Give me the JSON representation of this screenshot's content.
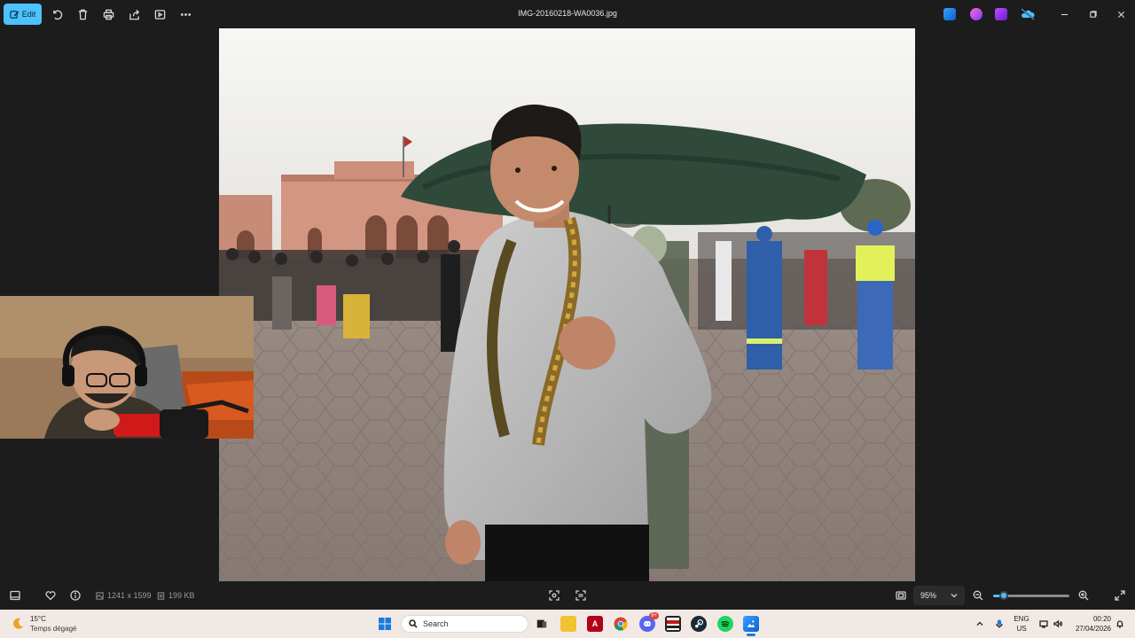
{
  "toolbar": {
    "edit_label": "Edit",
    "title": "IMG-20160218-WA0036.jpg",
    "icons": [
      "rotate-icon",
      "delete-icon",
      "print-icon",
      "share-icon",
      "slideshow-icon",
      "more-icon"
    ],
    "app_icons": [
      "photo-editor-app-icon",
      "clipchamp-app-icon",
      "video-editor-app-icon",
      "onedrive-off-icon"
    ]
  },
  "footer": {
    "dimensions": "1241 x 1599",
    "file_size": "199 KB",
    "zoom_value": "95%",
    "zoom_level": 0.14
  },
  "taskbar": {
    "temperature": "15°C",
    "weather": "Temps dégagé",
    "search_placeholder": "Search",
    "language": "ENG",
    "region": "US",
    "time": "00:20",
    "date": "27/04/2026",
    "notification_badge": "9+",
    "apps": [
      "windows-start-icon",
      "search-app",
      "task-view-icon",
      "file-explorer-icon",
      "acrobat-icon",
      "chrome-icon",
      "discord-icon",
      "manga-app-icon",
      "steam-icon",
      "spotify-icon",
      "photos-app-icon"
    ]
  },
  "colors": {
    "accent": "#4cc2ff",
    "background": "#1c1c1c",
    "taskbar": "#f3e9e4"
  }
}
